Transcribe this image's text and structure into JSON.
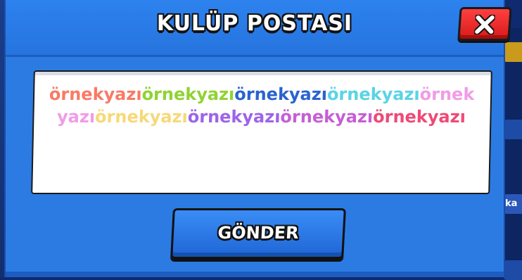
{
  "dialog": {
    "title": "KULÜP POSTASI",
    "close_icon": "close-icon",
    "message_segments": [
      {
        "text": "örnekyazı",
        "color": "#f87a66"
      },
      {
        "text": "örnekyazı",
        "color": "#8fd332"
      },
      {
        "text": "örnekyazı",
        "color": "#2a63cf"
      },
      {
        "text": "örnekyazı",
        "color": "#5bd3e6"
      },
      {
        "text": "ör",
        "color": "#f19ce6"
      },
      {
        "text": "nekyazı",
        "color": "#f19ce6"
      },
      {
        "text": "örnekyazı",
        "color": "#f6d978"
      },
      {
        "text": "örnekyazı",
        "color": "#9d64e8"
      },
      {
        "text": "örnekyazı",
        "color": "#c55fd4"
      },
      {
        "text": "örnekyazı",
        "color": "#ee4a77"
      }
    ],
    "send_label": "GÖNDER"
  },
  "background": {
    "side_label": "ka"
  },
  "colors": {
    "dialog_blue": "#2c7be3",
    "close_red": "#e32222",
    "panel_white": "#ffffff"
  }
}
